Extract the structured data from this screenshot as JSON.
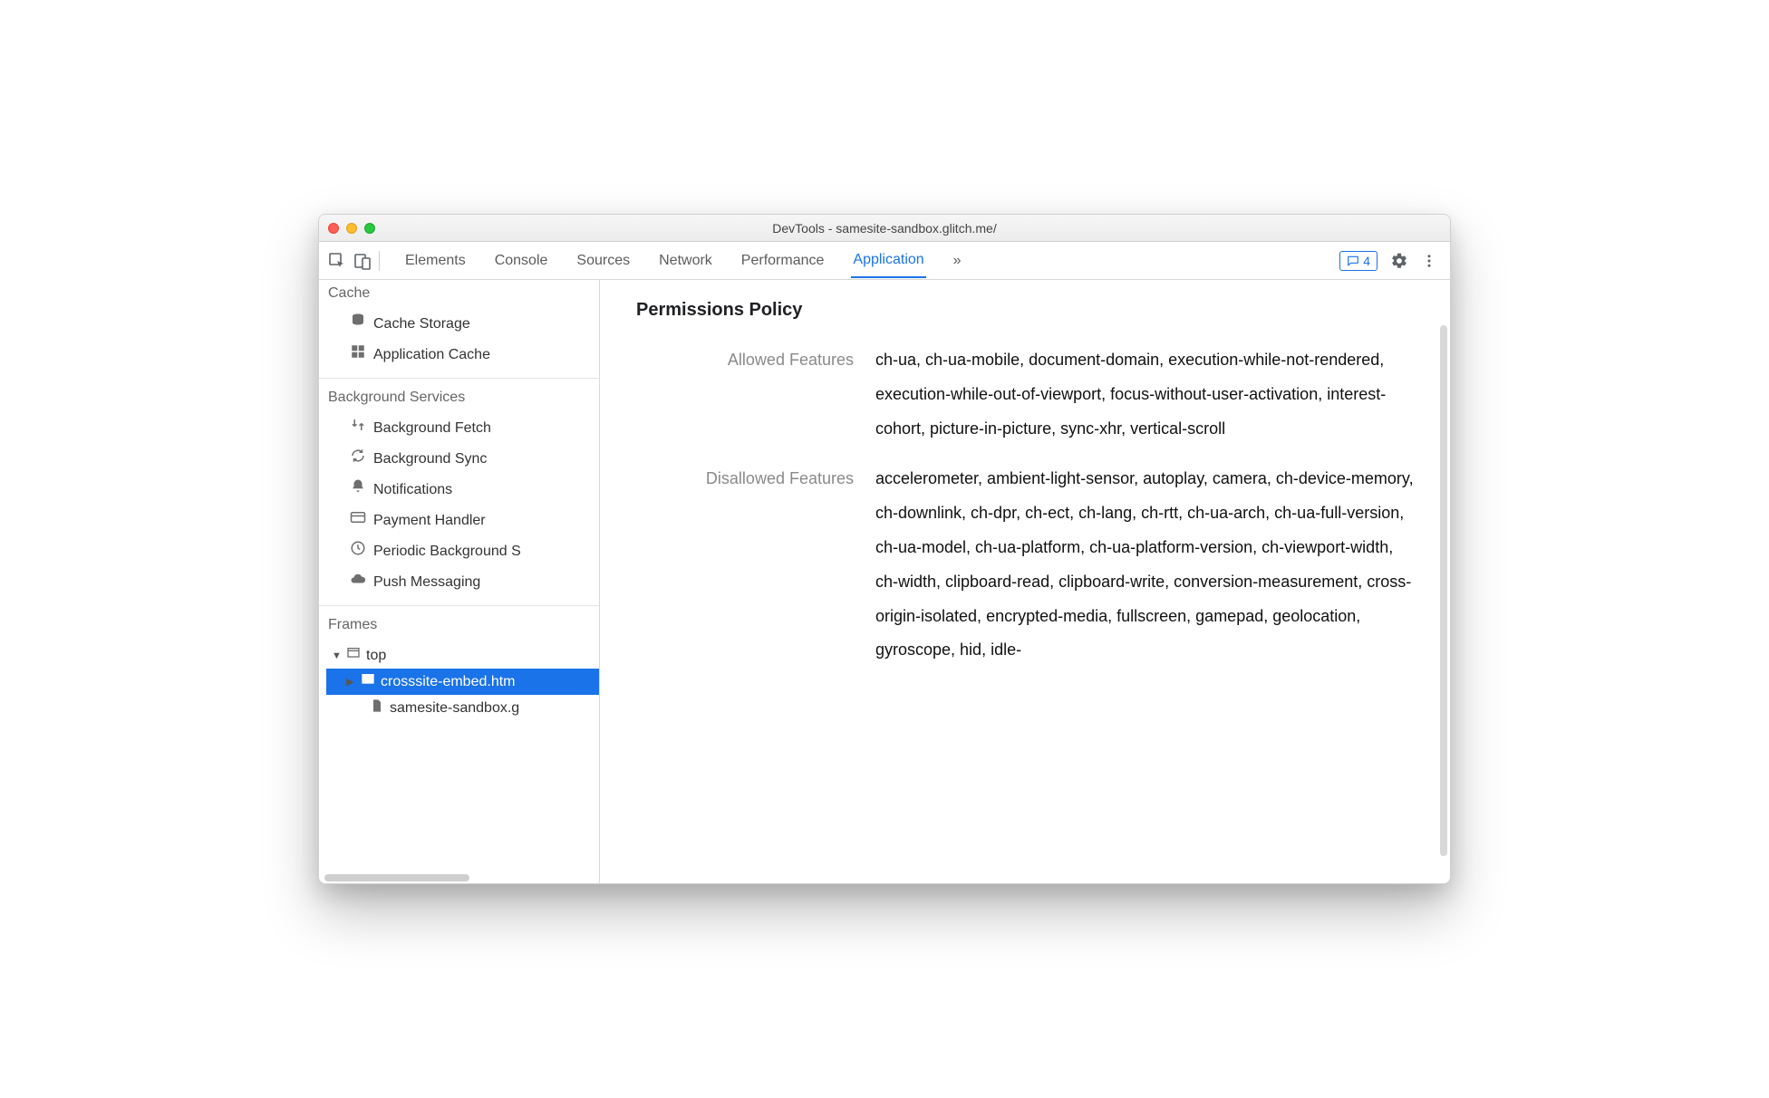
{
  "window": {
    "title": "DevTools - samesite-sandbox.glitch.me/"
  },
  "tabs": {
    "items": [
      "Elements",
      "Console",
      "Sources",
      "Network",
      "Performance",
      "Application"
    ],
    "more": "»",
    "active": "Application",
    "badge_count": "4"
  },
  "sidebar": {
    "cache": {
      "header": "Cache",
      "items": [
        "Cache Storage",
        "Application Cache"
      ]
    },
    "bgservices": {
      "header": "Background Services",
      "items": [
        "Background Fetch",
        "Background Sync",
        "Notifications",
        "Payment Handler",
        "Periodic Background S",
        "Push Messaging"
      ]
    },
    "frames": {
      "header": "Frames",
      "top": "top",
      "child1": "crosssite-embed.htm",
      "child2": "samesite-sandbox.g"
    }
  },
  "content": {
    "heading": "Permissions Policy",
    "allowed_label": "Allowed Features",
    "allowed_value": "ch-ua, ch-ua-mobile, document-domain, execution-while-not-rendered, execution-while-out-of-viewport, focus-without-user-activation, interest-cohort, picture-in-picture, sync-xhr, vertical-scroll",
    "disallowed_label": "Disallowed Features",
    "disallowed_value": "accelerometer, ambient-light-sensor, autoplay, camera, ch-device-memory, ch-downlink, ch-dpr, ch-ect, ch-lang, ch-rtt, ch-ua-arch, ch-ua-full-version, ch-ua-model, ch-ua-platform, ch-ua-platform-version, ch-viewport-width, ch-width, clipboard-read, clipboard-write, conversion-measurement, cross-origin-isolated, encrypted-media, fullscreen, gamepad, geolocation, gyroscope, hid, idle-"
  }
}
